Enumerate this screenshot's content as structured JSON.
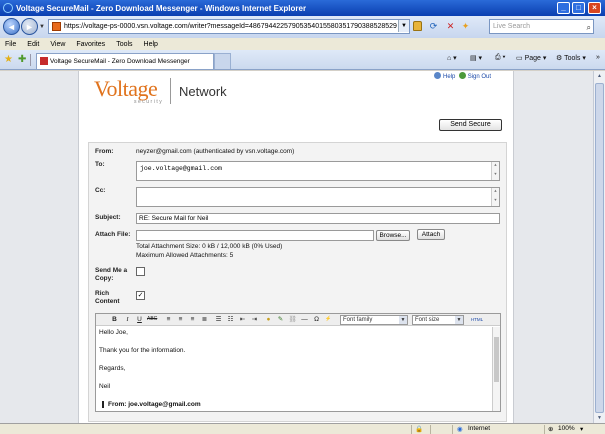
{
  "window": {
    "title": "Voltage SecureMail - Zero Download Messenger - Windows Internet Explorer"
  },
  "address": {
    "url": "https://voltage-ps-0000.vsn.voltage.com/writer?messageId=4867944225790535401558035179038852852­9",
    "search_placeholder": "Live Search"
  },
  "menu": [
    "File",
    "Edit",
    "View",
    "Favorites",
    "Tools",
    "Help"
  ],
  "tab": {
    "title": "Voltage SecureMail - Zero Download Messenger"
  },
  "toolbar": {
    "page": "Page",
    "tools": "Tools"
  },
  "header": {
    "help": "Help",
    "signout": "Sign Out",
    "logo": "Voltage",
    "logo_sub": "security",
    "network": "Network",
    "send_button": "Send Secure"
  },
  "form": {
    "from_label": "From:",
    "from_value": "neyzer@gmail.com (authenticated by vsn.voltage.com)",
    "to_label": "To:",
    "to_value": "joe.voltage@gmail.com",
    "cc_label": "Cc:",
    "cc_value": "",
    "subject_label": "Subject:",
    "subject_value": "RE: Secure Mail for Neil",
    "attach_label": "Attach File:",
    "browse_button": "Browse...",
    "attach_button": "Attach",
    "attach_size": "Total Attachment Size: 0 kB / 12,000 kB (0% Used)",
    "attach_max": "Maximum Allowed Attachments: 5",
    "copy_label_1": "Send Me a",
    "copy_label_2": "Copy:",
    "copy_checked": false,
    "rich_label_1": "Rich",
    "rich_label_2": "Content",
    "rich_checked": "✓"
  },
  "editor": {
    "font_family": "Font family",
    "font_size": "Font size",
    "html_btn": "HTML",
    "bold": "B",
    "italic": "I",
    "underline": "U",
    "strike": "ABC",
    "omega": "Ω",
    "body": {
      "line1": "Hello Joe,",
      "line2": "Thank you for the information.",
      "line3": "Regards,",
      "line4": "Neil",
      "quote": "From: joe.voltage@gmail.com"
    }
  },
  "status": {
    "zone": "Internet",
    "zoom": "100%"
  }
}
